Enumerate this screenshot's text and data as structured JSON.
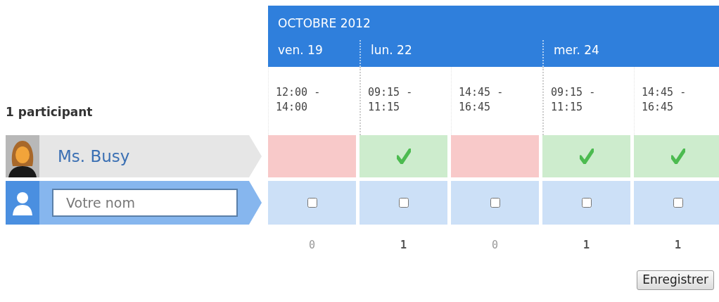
{
  "month": "OCTOBRE 2012",
  "days": [
    {
      "label": "ven. 19",
      "slots": [
        {
          "time": "12:00 - 14:00"
        }
      ]
    },
    {
      "label": "lun. 22",
      "slots": [
        {
          "time": "09:15 - 11:15"
        },
        {
          "time": "14:45 - 16:45"
        }
      ]
    },
    {
      "label": "mer. 24",
      "slots": [
        {
          "time": "09:15 - 11:15"
        },
        {
          "time": "14:45 - 16:45"
        }
      ]
    }
  ],
  "participant_count": "1 participant",
  "participants": [
    {
      "name": "Ms. Busy",
      "votes": [
        {
          "available": false
        },
        {
          "available": true
        },
        {
          "available": false
        },
        {
          "available": true
        },
        {
          "available": true
        }
      ]
    }
  ],
  "new_entry": {
    "placeholder": "Votre nom",
    "choices": [
      {
        "checked": false
      },
      {
        "checked": false
      },
      {
        "checked": false
      },
      {
        "checked": false
      },
      {
        "checked": false
      }
    ]
  },
  "totals": [
    {
      "count": "0",
      "best": false
    },
    {
      "count": "1",
      "best": true
    },
    {
      "count": "0",
      "best": false
    },
    {
      "count": "1",
      "best": true
    },
    {
      "count": "1",
      "best": true
    }
  ],
  "save_button": "Enregistrer"
}
